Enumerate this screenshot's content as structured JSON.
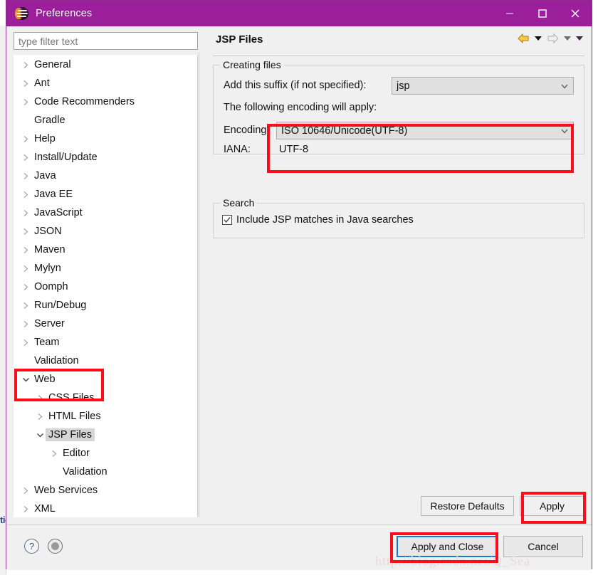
{
  "window": {
    "title": "Preferences",
    "logo_icon": "eclipse-logo-icon",
    "minimize_icon": "minimize-icon",
    "maximize_icon": "maximize-icon",
    "close_icon": "close-icon"
  },
  "background": {
    "edge_text": "tic"
  },
  "filter": {
    "placeholder": "type filter text",
    "value": ""
  },
  "tree": {
    "items": [
      {
        "label": "General",
        "depth": 0,
        "twisty": "collapsed",
        "selected": false
      },
      {
        "label": "Ant",
        "depth": 0,
        "twisty": "collapsed",
        "selected": false
      },
      {
        "label": "Code Recommenders",
        "depth": 0,
        "twisty": "collapsed",
        "selected": false
      },
      {
        "label": "Gradle",
        "depth": 0,
        "twisty": "none",
        "selected": false
      },
      {
        "label": "Help",
        "depth": 0,
        "twisty": "collapsed",
        "selected": false
      },
      {
        "label": "Install/Update",
        "depth": 0,
        "twisty": "collapsed",
        "selected": false
      },
      {
        "label": "Java",
        "depth": 0,
        "twisty": "collapsed",
        "selected": false
      },
      {
        "label": "Java EE",
        "depth": 0,
        "twisty": "collapsed",
        "selected": false
      },
      {
        "label": "JavaScript",
        "depth": 0,
        "twisty": "collapsed",
        "selected": false
      },
      {
        "label": "JSON",
        "depth": 0,
        "twisty": "collapsed",
        "selected": false
      },
      {
        "label": "Maven",
        "depth": 0,
        "twisty": "collapsed",
        "selected": false
      },
      {
        "label": "Mylyn",
        "depth": 0,
        "twisty": "collapsed",
        "selected": false
      },
      {
        "label": "Oomph",
        "depth": 0,
        "twisty": "collapsed",
        "selected": false
      },
      {
        "label": "Run/Debug",
        "depth": 0,
        "twisty": "collapsed",
        "selected": false
      },
      {
        "label": "Server",
        "depth": 0,
        "twisty": "collapsed",
        "selected": false
      },
      {
        "label": "Team",
        "depth": 0,
        "twisty": "collapsed",
        "selected": false
      },
      {
        "label": "Validation",
        "depth": 0,
        "twisty": "none",
        "selected": false
      },
      {
        "label": "Web",
        "depth": 0,
        "twisty": "expanded",
        "selected": false
      },
      {
        "label": "CSS Files",
        "depth": 1,
        "twisty": "collapsed",
        "selected": false
      },
      {
        "label": "HTML Files",
        "depth": 1,
        "twisty": "collapsed",
        "selected": false
      },
      {
        "label": "JSP Files",
        "depth": 1,
        "twisty": "expanded",
        "selected": true
      },
      {
        "label": "Editor",
        "depth": 2,
        "twisty": "collapsed",
        "selected": false
      },
      {
        "label": "Validation",
        "depth": 2,
        "twisty": "none",
        "selected": false
      },
      {
        "label": "Web Services",
        "depth": 0,
        "twisty": "collapsed",
        "selected": false
      },
      {
        "label": "XML",
        "depth": 0,
        "twisty": "collapsed",
        "selected": false
      }
    ]
  },
  "content": {
    "title": "JSP Files",
    "nav": {
      "back_icon": "back-arrow-icon",
      "back_menu_icon": "chevron-down-icon",
      "forward_icon": "forward-arrow-icon",
      "forward_menu_icon": "chevron-down-icon",
      "view_menu_icon": "chevron-down-icon"
    },
    "creating_files": {
      "group_label": "Creating files",
      "suffix_label": "Add this suffix (if not specified):",
      "suffix_value": "jsp",
      "encoding_note": "The following encoding will apply:",
      "encoding_label": "Encoding:",
      "encoding_value": "ISO 10646/Unicode(UTF-8)",
      "iana_label": "IANA:",
      "iana_value": "UTF-8"
    },
    "search": {
      "group_label": "Search",
      "checkbox_label": "Include JSP matches in Java searches",
      "checkbox_checked": true
    },
    "buttons": {
      "restore_defaults": "Restore Defaults",
      "apply": "Apply"
    }
  },
  "footer": {
    "help_icon": "question-mark-icon",
    "secondary_icon": "oomph-recorder-icon",
    "apply_and_close": "Apply and Close",
    "cancel": "Cancel"
  },
  "watermark": {
    "text": "http://blog.csdn.net/Q_Sea"
  },
  "colors": {
    "titlebar": "#9b1f9b",
    "annotation": "#fc0d1b",
    "focus_border": "#1a78d2",
    "selection": "#d6d6d6"
  }
}
